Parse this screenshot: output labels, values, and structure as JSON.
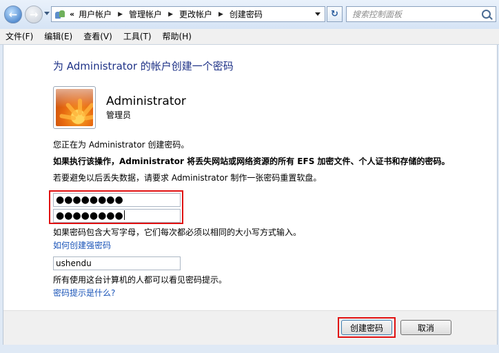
{
  "nav": {
    "breadcrumb_lead": "«",
    "breadcrumbs": [
      "用户帐户",
      "管理帐户",
      "更改帐户",
      "创建密码"
    ],
    "search_placeholder": "搜索控制面板"
  },
  "menu": [
    "文件(F)",
    "编辑(E)",
    "查看(V)",
    "工具(T)",
    "帮助(H)"
  ],
  "main": {
    "title": "为 Administrator 的帐户创建一个密码",
    "account_name": "Administrator",
    "account_role": "管理员",
    "line1": "您正在为 Administrator 创建密码。",
    "warning": "如果执行该操作，Administrator 将丢失网站或网络资源的所有 EFS 加密文件、个人证书和存储的密码。",
    "line3": "若要避免以后丢失数据，请要求 Administrator 制作一张密码重置软盘。",
    "password": "●●●●●●●●",
    "password_confirm": "●●●●●●●●",
    "case_note": "如果密码包含大写字母，它们每次都必须以相同的大小写方式输入。",
    "strong_link": "如何创建强密码",
    "hint_value": "ushendu",
    "hint_note": "所有使用这台计算机的人都可以看见密码提示。",
    "hint_link": "密码提示是什么?"
  },
  "buttons": {
    "create": "创建密码",
    "cancel": "取消"
  },
  "colors": {
    "title": "#1e3287",
    "link": "#1a54b8",
    "highlight": "#e01010"
  }
}
